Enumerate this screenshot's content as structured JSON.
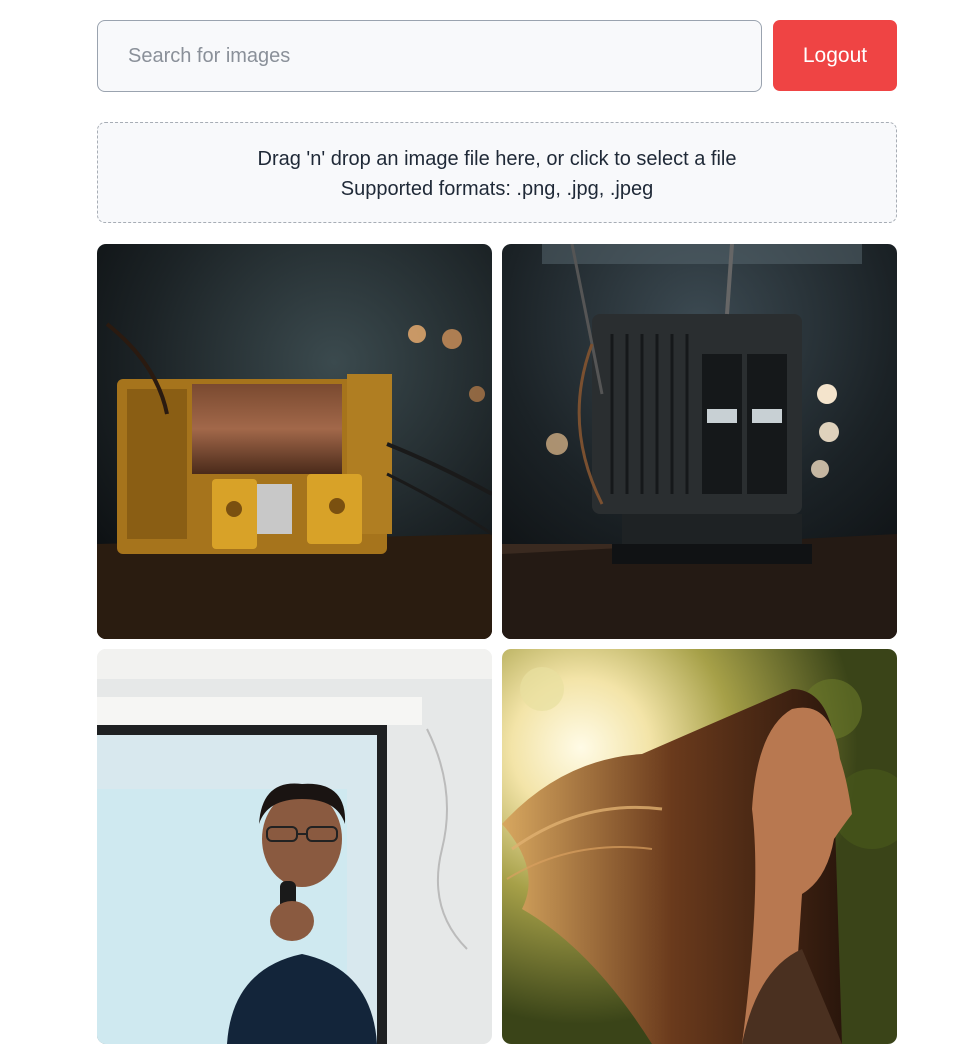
{
  "search": {
    "placeholder": "Search for images",
    "value": ""
  },
  "header": {
    "logout_label": "Logout",
    "logout_color": "#ef4444"
  },
  "dropzone": {
    "line1": "Drag 'n' drop an image file here, or click to select a file",
    "line2": "Supported formats: .png, .jpg, .jpeg"
  },
  "gallery": {
    "images": [
      {
        "subject": "vintage brass transformer on wooden workbench"
      },
      {
        "subject": "black electrical transformer unit on table"
      },
      {
        "subject": "man speaking into microphone in front of projector screen"
      },
      {
        "subject": "woman with flowing hair in golden sunlight"
      }
    ]
  }
}
